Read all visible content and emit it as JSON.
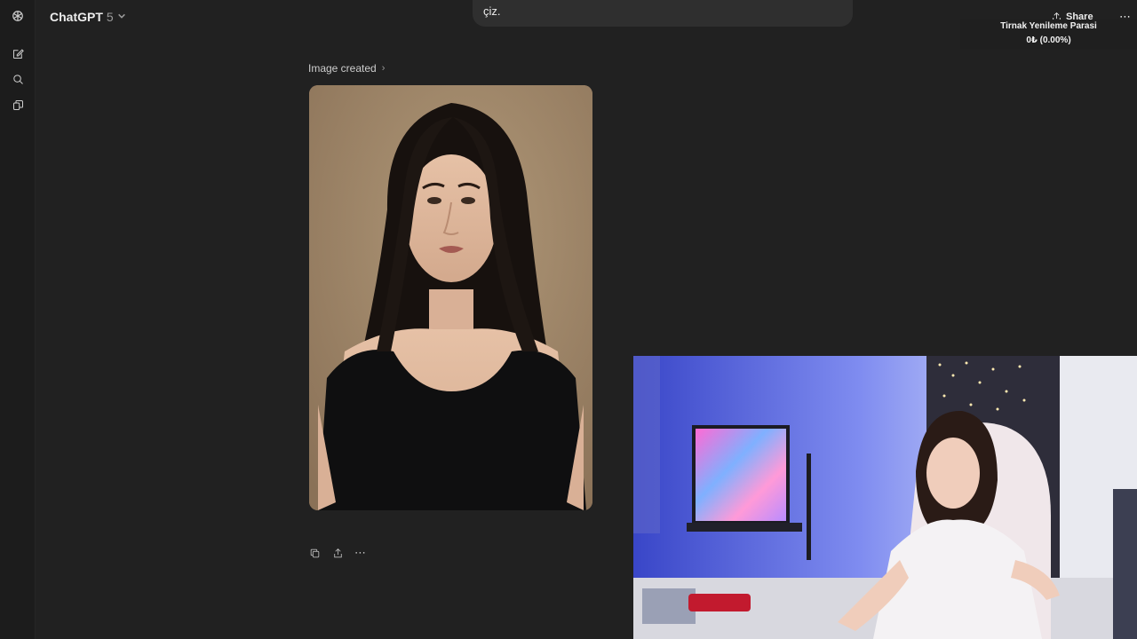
{
  "header": {
    "model_name": "ChatGPT",
    "model_version": "5",
    "share_label": "Share"
  },
  "prompt": {
    "visible_text": "çiz."
  },
  "overlay": {
    "donation_title": "Tirnak Yenileme Parasi",
    "donation_value": "0₺ (0.00%)"
  },
  "message": {
    "image_created_label": "Image created"
  },
  "colors": {
    "background": "#212121",
    "rail": "#1c1c1c",
    "bubble": "#2f2f2f",
    "text": "#ececec",
    "muted": "#9b9b9b"
  },
  "icons": {
    "rail": [
      "openai-logo-icon",
      "new-chat-icon",
      "search-icon",
      "library-icon"
    ],
    "actions": [
      "copy-icon",
      "share-icon",
      "more-icon"
    ]
  }
}
